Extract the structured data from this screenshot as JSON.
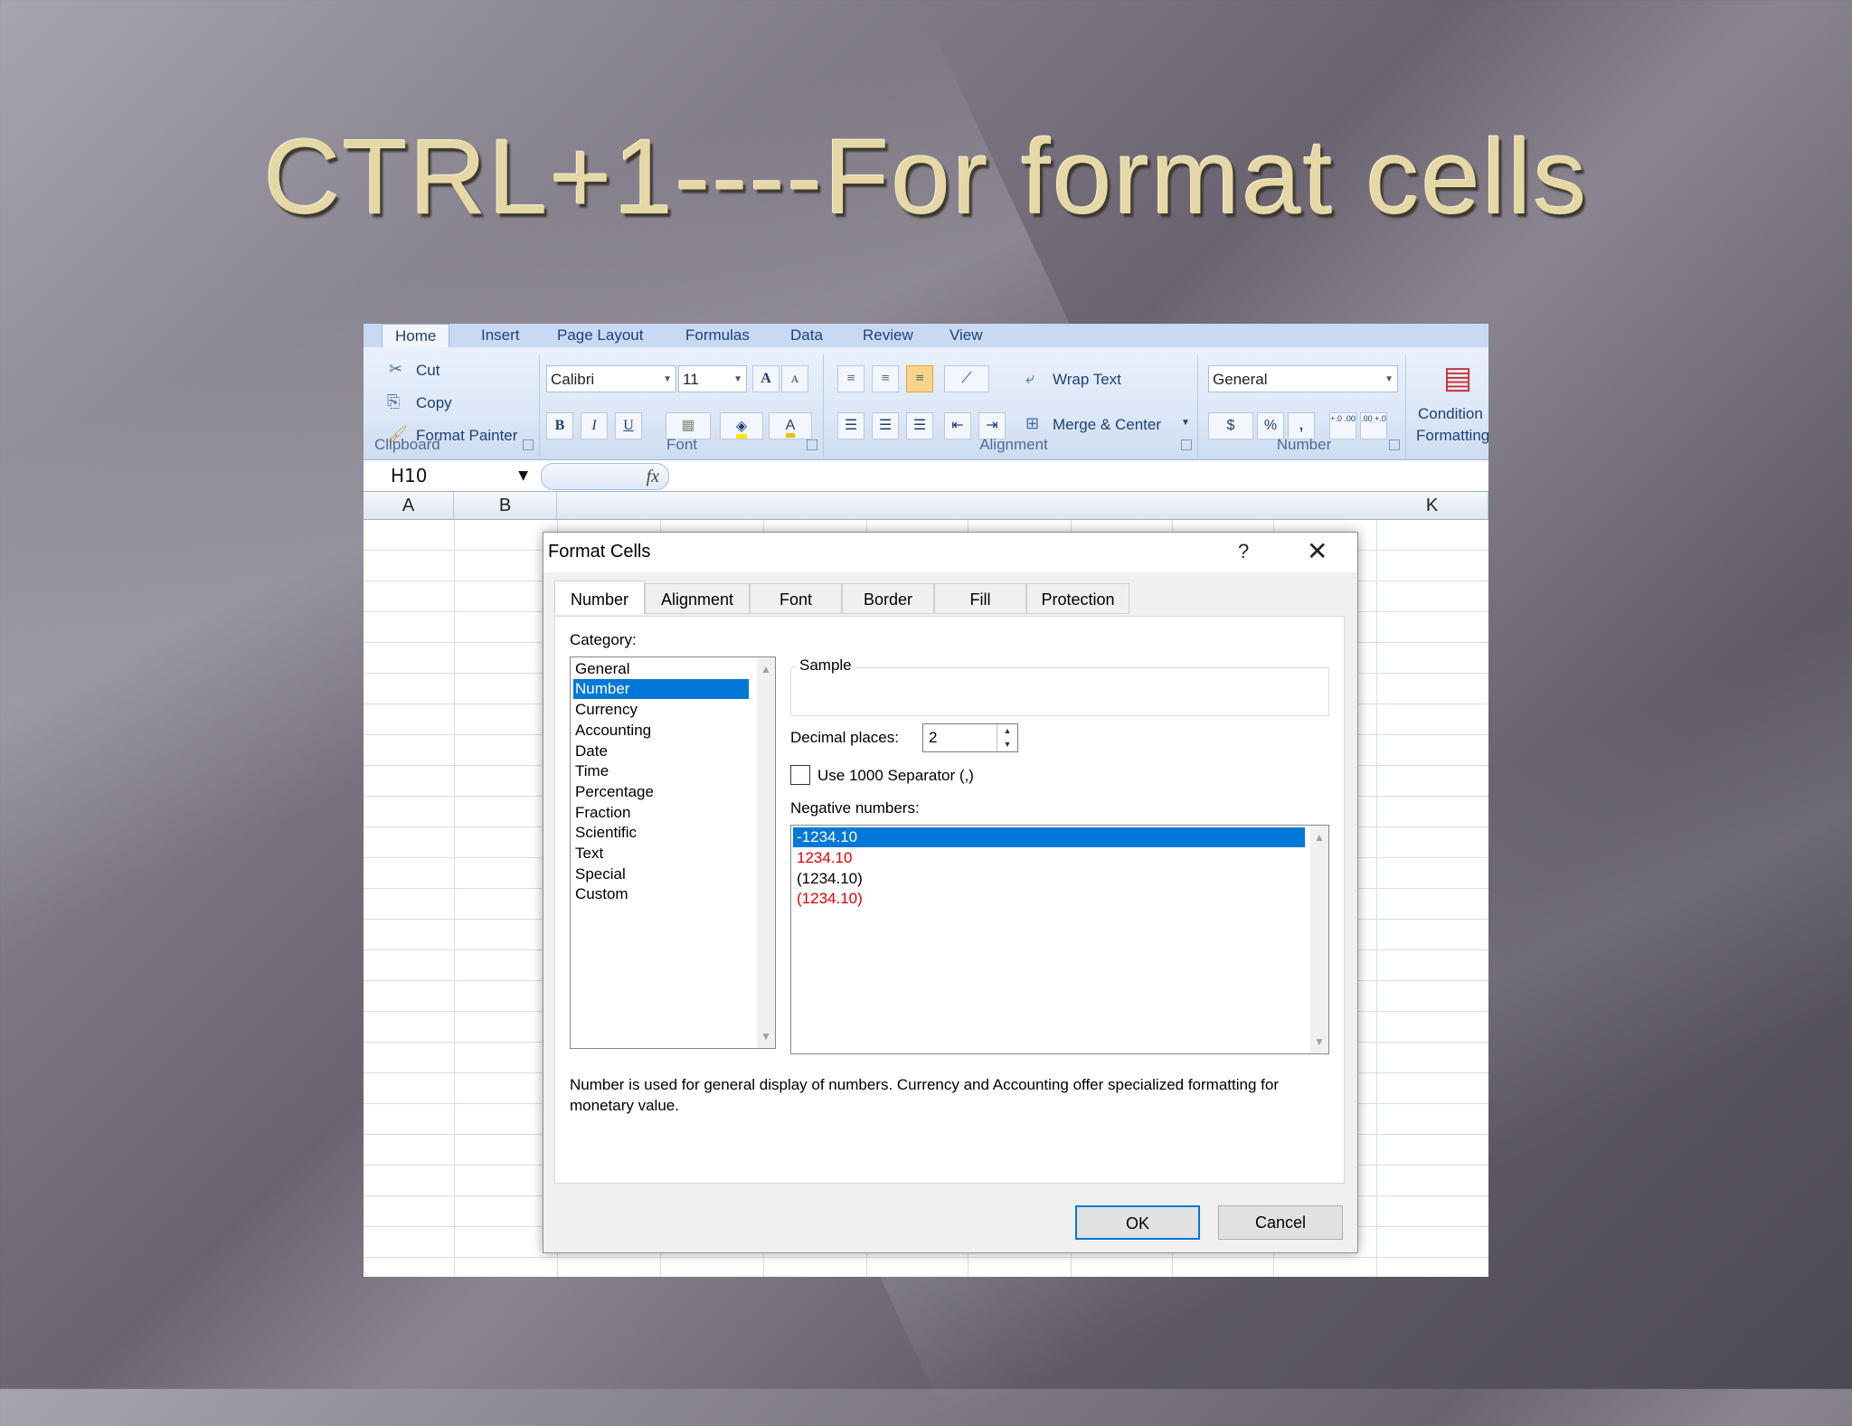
{
  "slide": {
    "title": "CTRL+1----For format cells"
  },
  "ribbon": {
    "tabs": [
      "Home",
      "Insert",
      "Page Layout",
      "Formulas",
      "Data",
      "Review",
      "View"
    ],
    "clipboard": {
      "label": "Clipboard",
      "cut": "Cut",
      "copy": "Copy",
      "format_painter": "Format Painter"
    },
    "font": {
      "label": "Font",
      "family": "Calibri",
      "size": "11",
      "bold": "B",
      "italic": "I",
      "underline": "U",
      "grow": "A",
      "shrink": "A",
      "font_color": "A"
    },
    "alignment": {
      "label": "Alignment",
      "wrap_text": "Wrap Text",
      "merge_center": "Merge & Center"
    },
    "number": {
      "label": "Number",
      "format": "General",
      "currency": "$",
      "percent": "%",
      "comma": ",",
      "inc_decimal": "+.0 .00",
      "dec_decimal": ".00 +.0"
    },
    "styles": {
      "conditional_1": "Condition",
      "conditional_2": "Formatting"
    }
  },
  "formula_bar": {
    "name_box": "H10",
    "fx": "fx"
  },
  "columns": [
    "A",
    "B",
    "K"
  ],
  "dialog": {
    "title": "Format Cells",
    "help": "?",
    "close": "✕",
    "tabs": [
      "Number",
      "Alignment",
      "Font",
      "Border",
      "Fill",
      "Protection"
    ],
    "category_label": "Category:",
    "categories": [
      "General",
      "Number",
      "Currency",
      "Accounting",
      "Date",
      "Time",
      "Percentage",
      "Fraction",
      "Scientific",
      "Text",
      "Special",
      "Custom"
    ],
    "selected_category": "Number",
    "sample_label": "Sample",
    "decimal_label": "Decimal places:",
    "decimal_value": "2",
    "separator_label": "Use 1000 Separator (,)",
    "negative_label": "Negative numbers:",
    "negative_options": [
      "-1234.10",
      "1234.10",
      "(1234.10)",
      "(1234.10)"
    ],
    "description": "Number is used for general display of numbers.  Currency and Accounting offer specialized formatting for monetary value.",
    "ok": "OK",
    "cancel": "Cancel"
  },
  "colors": {
    "selection": "#0078d7",
    "negative_red": "#e00000",
    "ribbon_text": "#1e3f78"
  }
}
